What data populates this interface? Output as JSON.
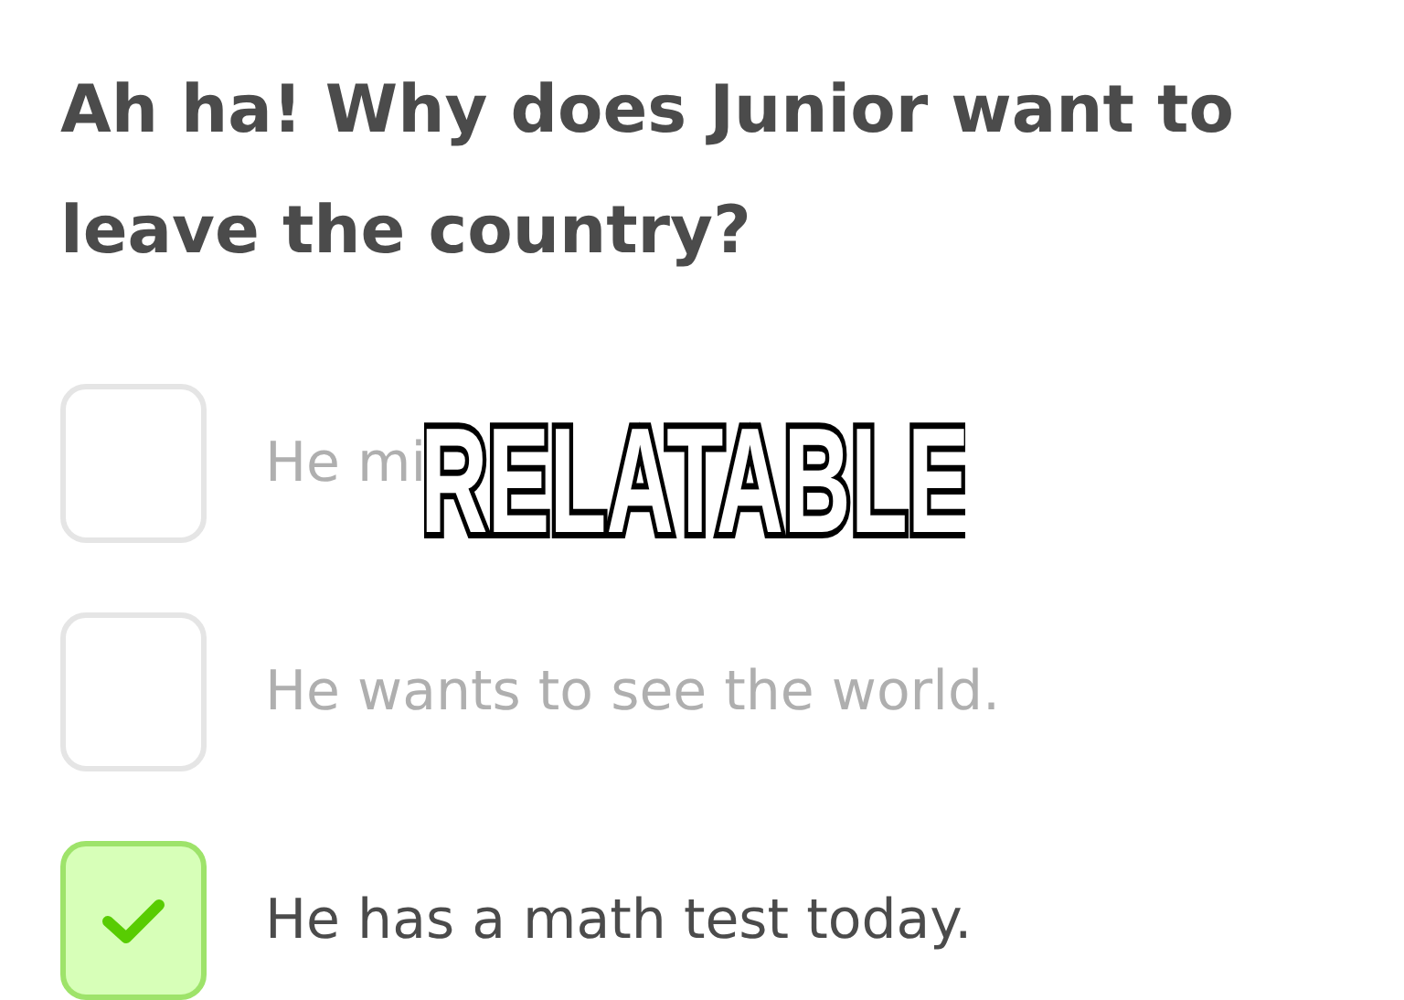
{
  "question": "Ah ha! Why does Junior want to leave the country?",
  "options": [
    {
      "text": "He mi",
      "selected": false
    },
    {
      "text": "He wants to see the world.",
      "selected": false
    },
    {
      "text": "He has a math test today.",
      "selected": true
    }
  ],
  "caption": "RELATABLE"
}
